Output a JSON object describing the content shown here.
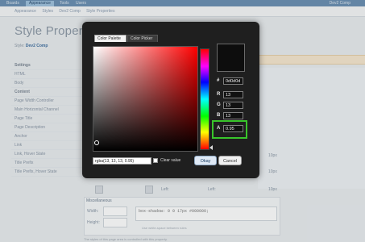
{
  "topbar": {
    "tabs": [
      "Boards",
      "Appearance",
      "Tools",
      "Users"
    ],
    "user": "Dev2 Comp"
  },
  "breadcrumbs": [
    "Appearance",
    "Styles",
    "Dev2 Comp",
    "Style Properties"
  ],
  "page": {
    "title": "Style Properties: Dev2 Comp",
    "style_label": "Style:",
    "style_value": "Dev2 Comp"
  },
  "sidebar": {
    "items": [
      {
        "label": "Settings",
        "head": true
      },
      {
        "label": "HTML",
        "head": false
      },
      {
        "label": "Body",
        "head": false
      },
      {
        "label": "Content",
        "head": true
      },
      {
        "label": "Page Width Controller",
        "head": false
      },
      {
        "label": "Main Horizontal Channel",
        "head": false
      },
      {
        "label": "Page Title",
        "head": false
      },
      {
        "label": "Page Description",
        "head": false
      },
      {
        "label": "Anchor",
        "head": false
      },
      {
        "label": "Link",
        "head": false
      },
      {
        "label": "Link, Hover State",
        "head": false
      },
      {
        "label": "Title Prefix",
        "head": false
      },
      {
        "label": "Title Prefix, Hover State",
        "head": false
      }
    ]
  },
  "background_rows": {
    "px_values": [
      "10px",
      "10px",
      "10px"
    ],
    "left_label": "Left:"
  },
  "bottom_panel": {
    "title": "Miscellaneous",
    "width_label": "Width:",
    "height_label": "Height:",
    "code": "box-shadow: 0 0 17px #000000;",
    "hint": "Use white-space between rules",
    "footer": "The styles of this page area is controlled with this property."
  },
  "color_picker": {
    "tabs": [
      "Color Palette",
      "Color Picker"
    ],
    "hex_label": "#",
    "hex_value": "0d0d0d",
    "r_label": "R",
    "r_value": "13",
    "g_label": "G",
    "g_value": "13",
    "b_label": "B",
    "b_value": "13",
    "a_label": "A",
    "a_value": "0.95",
    "rgba_value": "rgba(13, 13, 13, 0.95)",
    "clear_label": "Clear value",
    "ok_label": "Okay",
    "cancel_label": "Cancel",
    "preview_color": "#0d0d0d",
    "highlight_color": "#39c52b"
  }
}
